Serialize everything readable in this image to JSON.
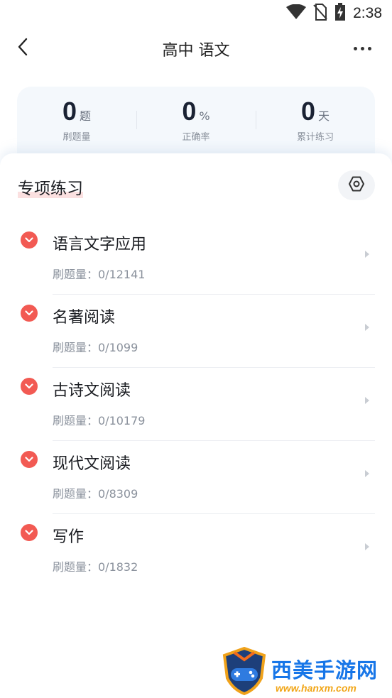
{
  "status_bar": {
    "time": "2:38",
    "icons": [
      "wifi-icon",
      "no-sim-icon",
      "battery-charging-icon"
    ]
  },
  "nav": {
    "title": "高中 语文",
    "back_icon": "chevron-left-icon",
    "more_icon": "more-horizontal-icon"
  },
  "stats": [
    {
      "value": "0",
      "unit": "题",
      "label": "刷题量"
    },
    {
      "value": "0",
      "unit": "%",
      "label": "正确率"
    },
    {
      "value": "0",
      "unit": "天",
      "label": "累计练习"
    }
  ],
  "section": {
    "title": "专项练习",
    "settings_icon": "hexagon-settings-icon"
  },
  "items": [
    {
      "name": "语言文字应用",
      "count": "刷题量：0/12141"
    },
    {
      "name": "名著阅读",
      "count": "刷题量：0/1099"
    },
    {
      "name": "古诗文阅读",
      "count": "刷题量：0/10179"
    },
    {
      "name": "现代文阅读",
      "count": "刷题量：0/8309"
    },
    {
      "name": "写作",
      "count": "刷题量：0/1832"
    }
  ],
  "watermark": {
    "text": "西美手游网",
    "url": "www.hanxm.com"
  },
  "colors": {
    "accent_red": "#f25a53",
    "stats_bg": "#f4f8fc",
    "watermark_blue": "#1776e8",
    "watermark_orange": "#f1a516"
  }
}
